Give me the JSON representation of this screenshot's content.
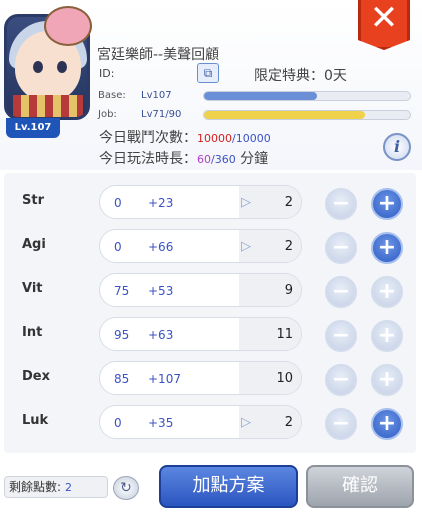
{
  "character": {
    "name": "宮廷樂師--美聲回顧",
    "level_badge": "Lv.107",
    "id_label": "ID:",
    "privilege_label": "限定特典：",
    "privilege_value": "0天",
    "base_label": "Base:",
    "base_value": "Lv107",
    "base_progress": 0.55,
    "job_label": "Job:",
    "job_value": "Lv71/90",
    "job_progress": 0.78,
    "battles_label": "今日戰鬥次數：",
    "battles_used": "10000",
    "battles_total": "/10000",
    "playtime_label": "今日玩法時長：",
    "playtime_used": "60",
    "playtime_total": "/360",
    "playtime_unit": "分鐘"
  },
  "stats": [
    {
      "name": "Str",
      "base": "0",
      "bonus": "+23",
      "arrow": "▷",
      "result": "2",
      "plus_active": true
    },
    {
      "name": "Agi",
      "base": "0",
      "bonus": "+66",
      "arrow": "▷",
      "result": "2",
      "plus_active": true
    },
    {
      "name": "Vit",
      "base": "75",
      "bonus": "+53",
      "arrow": "",
      "result": "9",
      "plus_active": false
    },
    {
      "name": "Int",
      "base": "95",
      "bonus": "+63",
      "arrow": "",
      "result": "11",
      "plus_active": false
    },
    {
      "name": "Dex",
      "base": "85",
      "bonus": "+107",
      "arrow": "",
      "result": "10",
      "plus_active": false
    },
    {
      "name": "Luk",
      "base": "0",
      "bonus": "+35",
      "arrow": "▷",
      "result": "2",
      "plus_active": true
    }
  ],
  "footer": {
    "remaining_label": "剩餘點數:",
    "remaining_value": "2",
    "plan_button": "加點方案",
    "confirm_button": "確認"
  },
  "icons": {
    "close": "close-icon",
    "copy": "copy-icon",
    "info": "info-icon",
    "refresh": "refresh-icon"
  },
  "colors": {
    "accent": "#2c56c0",
    "close": "#e8411f",
    "base_bar": "#6b8fd6",
    "job_bar": "#f0d24a",
    "highlight_red": "#d21f1f",
    "highlight_purple": "#b040c8"
  }
}
